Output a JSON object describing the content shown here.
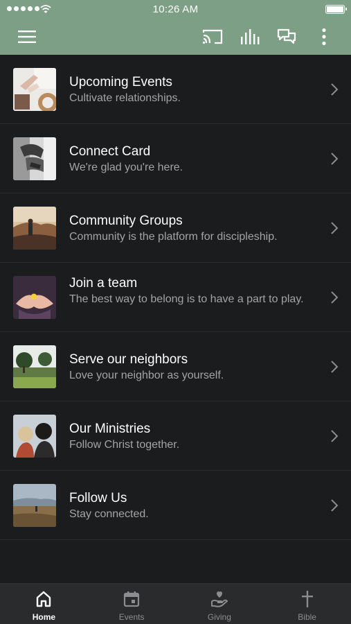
{
  "status_bar": {
    "time": "10:26 AM"
  },
  "app_bar": {
    "icons": [
      "menu-icon",
      "cast-icon",
      "audio-bars-icon",
      "chat-icon",
      "more-vert-icon"
    ]
  },
  "items": [
    {
      "title": "Upcoming Events",
      "subtitle": "Cultivate relationships."
    },
    {
      "title": "Connect Card",
      "subtitle": "We're glad you're here."
    },
    {
      "title": "Community Groups",
      "subtitle": "Community is the platform for discipleship."
    },
    {
      "title": "Join a team",
      "subtitle": "The best way to belong is to have a part to play."
    },
    {
      "title": "Serve our neighbors",
      "subtitle": "Love your neighbor as yourself."
    },
    {
      "title": "Our Ministries",
      "subtitle": "Follow Christ together."
    },
    {
      "title": "Follow Us",
      "subtitle": "Stay connected."
    }
  ],
  "tabs": [
    {
      "label": "Home",
      "icon": "home-icon",
      "active": true
    },
    {
      "label": "Events",
      "icon": "calendar-icon",
      "active": false
    },
    {
      "label": "Giving",
      "icon": "giving-hand-icon",
      "active": false
    },
    {
      "label": "Bible",
      "icon": "cross-icon",
      "active": false
    }
  ],
  "colors": {
    "header": "#7d9f86",
    "background": "#1b1c1e",
    "tabbar": "#2a2b2d"
  }
}
